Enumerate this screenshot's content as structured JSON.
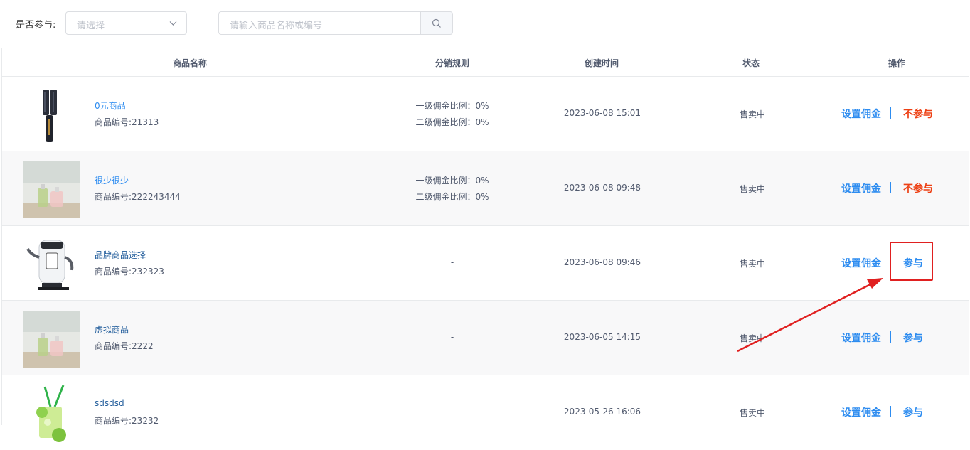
{
  "filter": {
    "participate_label": "是否参与:",
    "participate_placeholder": "请选择",
    "search_placeholder": "请输入商品名称或编号"
  },
  "table": {
    "headers": {
      "name": "商品名称",
      "rule": "分销规则",
      "created": "创建时间",
      "status": "状态",
      "action": "操作"
    },
    "rows": [
      {
        "name": "0元商品",
        "code": "商品编号:21313",
        "rule1": "一级佣金比例：0%",
        "rule2": "二级佣金比例：0%",
        "rule_dash": "",
        "created": "2023-06-08 15:01",
        "status": "售卖中",
        "set_label": "设置佣金",
        "toggle_label": "不参与"
      },
      {
        "name": "很少很少",
        "code": "商品编号:222243444",
        "rule1": "一级佣金比例：0%",
        "rule2": "二级佣金比例：0%",
        "rule_dash": "",
        "created": "2023-06-08 09:48",
        "status": "售卖中",
        "set_label": "设置佣金",
        "toggle_label": "不参与"
      },
      {
        "name": "品牌商品选择",
        "code": "商品编号:232323",
        "rule1": "",
        "rule2": "",
        "rule_dash": "-",
        "created": "2023-06-08 09:46",
        "status": "售卖中",
        "set_label": "设置佣金",
        "toggle_label": "参与"
      },
      {
        "name": "虚拟商品",
        "code": "商品编号:2222",
        "rule1": "",
        "rule2": "",
        "rule_dash": "-",
        "created": "2023-06-05 14:15",
        "status": "售卖中",
        "set_label": "设置佣金",
        "toggle_label": "参与"
      },
      {
        "name": "sdsdsd",
        "code": "商品编号:23232",
        "rule1": "",
        "rule2": "",
        "rule_dash": "-",
        "created": "2023-05-26 16:06",
        "status": "售卖中",
        "set_label": "设置佣金",
        "toggle_label": "参与"
      }
    ]
  },
  "colors": {
    "link_blue": "#2d8cf0",
    "danger_red": "#ed4014",
    "annotation_red": "#e02020"
  },
  "icons": {
    "chevron": "chevron-down-icon",
    "search": "search-icon"
  }
}
